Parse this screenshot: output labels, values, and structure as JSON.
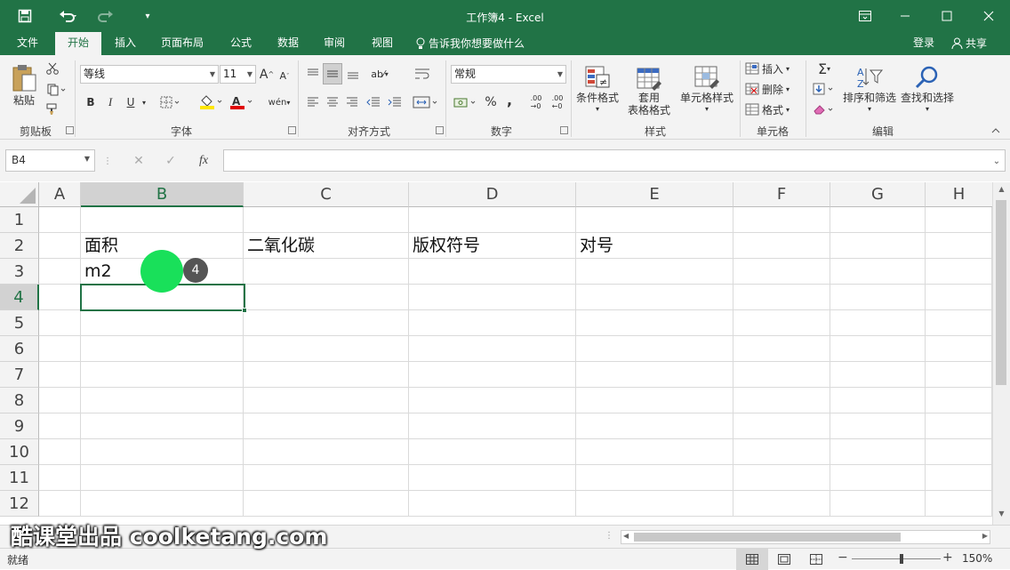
{
  "titlebar": {
    "title": "工作簿4 - Excel"
  },
  "tabs": [
    "文件",
    "开始",
    "插入",
    "页面布局",
    "公式",
    "数据",
    "审阅",
    "视图"
  ],
  "tellme": "告诉我你想要做什么",
  "account": {
    "login": "登录",
    "share": "共享"
  },
  "ribbon": {
    "clipboard": {
      "paste": "粘贴",
      "label": "剪贴板"
    },
    "font": {
      "name": "等线",
      "size": "11",
      "bold": "B",
      "italic": "I",
      "underline": "U",
      "label": "字体"
    },
    "alignment": {
      "label": "对齐方式"
    },
    "number": {
      "format": "常规",
      "percent": "%",
      "comma": ",",
      "label": "数字"
    },
    "styles": {
      "conditional": "条件格式",
      "table1": "套用",
      "table2": "表格格式",
      "cellstyle": "单元格样式",
      "label": "样式"
    },
    "cells": {
      "insert": "插入",
      "delete": "删除",
      "format": "格式",
      "label": "单元格"
    },
    "editing": {
      "sort": "排序和筛选",
      "find": "查找和选择",
      "label": "编辑"
    }
  },
  "formula": {
    "namebox": "B4",
    "fx": "fx"
  },
  "columns": [
    "A",
    "B",
    "C",
    "D",
    "E",
    "F",
    "G",
    "H"
  ],
  "rows": [
    "1",
    "2",
    "3",
    "4",
    "5",
    "6",
    "7",
    "8",
    "9",
    "10",
    "11",
    "12"
  ],
  "cells": {
    "B2": "面积",
    "C2": "二氧化碳",
    "D2": "版权符号",
    "E2": "对号",
    "B3": "m2"
  },
  "selected_cell": "B4",
  "step_badge": "4",
  "watermark": "酷课堂出品 coolketang.com",
  "status": {
    "ready": "就绪",
    "zoom": "150%"
  },
  "colors": {
    "accent": "#217346",
    "cursor": "#19e05a"
  }
}
